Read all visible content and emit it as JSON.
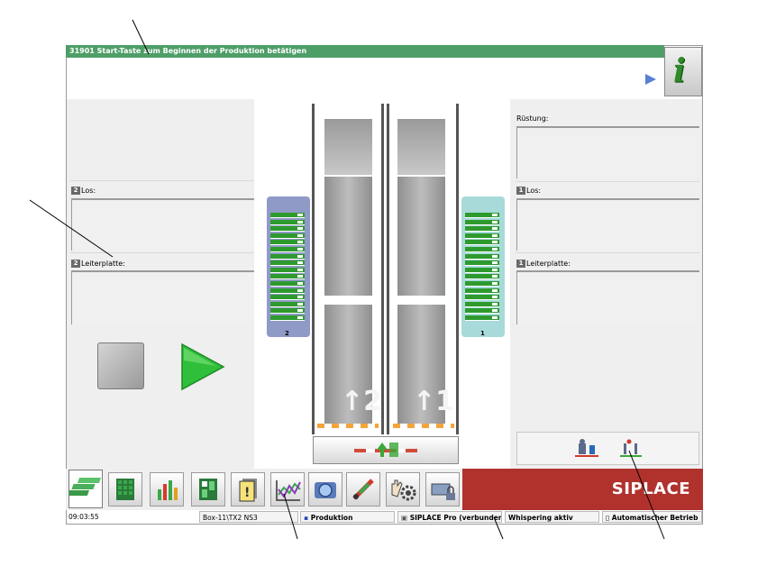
{
  "message": {
    "code": "31901",
    "text": "31901 Start-Taste zum Beginnen der Produktion betätigen"
  },
  "left_panel": {
    "los_label": "Los:",
    "leiterplatte_label": "Leiterplatte:",
    "track_icon": "2"
  },
  "right_panel": {
    "ruestung_label": "Rüstung:",
    "los_label": "Los:",
    "leiterplatte_label": "Leiterplatte:",
    "track_icon": "1"
  },
  "feeders": {
    "left": {
      "number": "2",
      "slots": 16,
      "color": "#8f9ac6"
    },
    "right": {
      "number": "1",
      "slots": 16,
      "color": "#a8dada"
    }
  },
  "conveyors": {
    "left_number": "2",
    "right_number": "1"
  },
  "brand": "SIPLACE",
  "status_bar": {
    "time": "09:03:55",
    "station": "Box-11\\TX2 NS3",
    "mode": "Produktion",
    "connection": "SIPLACE Pro (verbunden)",
    "whispering": "Whispering aktiv",
    "operation": "Automatischer Betrieb"
  },
  "colors": {
    "message_bar": "#4e9e68",
    "brand": "#b1322d",
    "go": "#2fbf3a"
  },
  "tabs": [
    "stack-icon",
    "grid-icon",
    "bar-chart-icon",
    "layout-icon",
    "warning-doc-icon",
    "trend-chart-icon",
    "camera-icon",
    "tool-icon",
    "hand-gear-icon",
    "lock-network-icon"
  ]
}
